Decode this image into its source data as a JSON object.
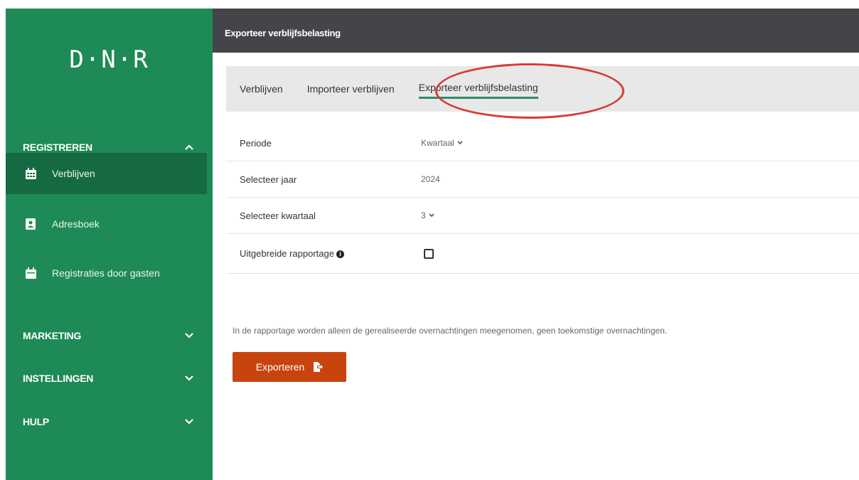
{
  "sidebar": {
    "logo": "D·N·R",
    "sections": {
      "registreren": "REGISTREREN",
      "marketing": "MARKETING",
      "instellingen": "INSTELLINGEN",
      "hulp": "HULP"
    },
    "items": [
      {
        "label": "Verblijven",
        "icon": "calendar-icon"
      },
      {
        "label": "Adresboek",
        "icon": "address-book-icon"
      },
      {
        "label": "Registraties door gasten",
        "icon": "calendar-icon"
      }
    ]
  },
  "topbar": {
    "title": "Exporteer verblijfsbelasting"
  },
  "tabs": [
    "Verblijven",
    "Importeer verblijven",
    "Exporteer verblijfsbelasting"
  ],
  "form": {
    "periode_label": "Periode",
    "periode_value": "Kwartaal",
    "jaar_label": "Selecteer jaar",
    "jaar_value": "2024",
    "kwartaal_label": "Selecteer kwartaal",
    "kwartaal_value": "3",
    "uitgebreid_label": "Uitgebreide rapportage",
    "uitgebreid_checked": false
  },
  "note": "In de rapportage worden alleen de gerealiseerde overnachtingen meegenomen, geen toekomstige overnachtingen.",
  "export_button": "Exporteren",
  "colors": {
    "sidebar": "#1e8a56",
    "active_item": "#166a42",
    "topbar": "#434548",
    "button": "#c7440f",
    "highlight": "#d83a3a"
  }
}
